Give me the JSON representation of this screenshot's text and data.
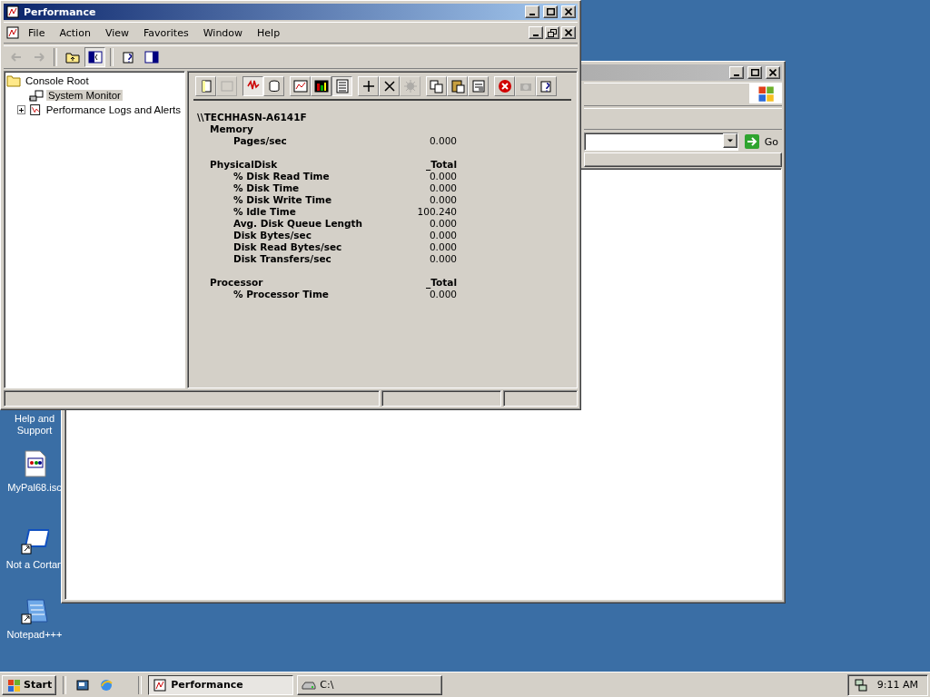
{
  "desktop_icons": [
    {
      "kind": "help",
      "label": "Help and Support"
    },
    {
      "kind": "document",
      "label": "MyPal68.isc"
    },
    {
      "kind": "shortcut-window",
      "label": "Not a Cortan"
    },
    {
      "kind": "notepad",
      "label": "Notepad+++"
    }
  ],
  "background_window": {
    "active": false,
    "address": {
      "go_label": "Go"
    }
  },
  "window": {
    "title": "Performance",
    "active": true,
    "menu": [
      {
        "label": "File"
      },
      {
        "label": "Action"
      },
      {
        "label": "View"
      },
      {
        "label": "Favorites"
      },
      {
        "label": "Window"
      },
      {
        "label": "Help"
      }
    ],
    "toolbar": [
      {
        "kind": "back",
        "disabled": true
      },
      {
        "kind": "forward",
        "disabled": true
      },
      {
        "kind": "sep"
      },
      {
        "kind": "up",
        "disabled": false
      },
      {
        "kind": "tree",
        "disabled": false,
        "pressed": true
      },
      {
        "kind": "sep"
      },
      {
        "kind": "help",
        "disabled": false
      },
      {
        "kind": "panel",
        "disabled": false
      }
    ],
    "tree": [
      {
        "label": "Console Root",
        "kind": "folder",
        "selected": false,
        "expanded": true,
        "children": [
          {
            "label": "System Monitor",
            "kind": "monitor",
            "selected": true
          },
          {
            "label": "Performance Logs and Alerts",
            "kind": "logs",
            "selected": false,
            "expanded": false
          }
        ]
      }
    ],
    "monitor_toolbar": [
      {
        "kind": "new",
        "pressed": false,
        "disabled": false
      },
      {
        "kind": "clear",
        "pressed": false,
        "disabled": true
      },
      {
        "kind": "sep"
      },
      {
        "kind": "current",
        "pressed": true,
        "disabled": false
      },
      {
        "kind": "log",
        "pressed": false,
        "disabled": false
      },
      {
        "kind": "sep"
      },
      {
        "kind": "graph",
        "pressed": false,
        "disabled": false
      },
      {
        "kind": "histogram",
        "pressed": false,
        "disabled": false
      },
      {
        "kind": "report",
        "pressed": true,
        "disabled": false
      },
      {
        "kind": "sep"
      },
      {
        "kind": "add",
        "pressed": false,
        "disabled": false
      },
      {
        "kind": "delete",
        "pressed": false,
        "disabled": false
      },
      {
        "kind": "highlight",
        "pressed": false,
        "disabled": true
      },
      {
        "kind": "sep"
      },
      {
        "kind": "copy",
        "pressed": false,
        "disabled": false
      },
      {
        "kind": "paste",
        "pressed": false,
        "disabled": false
      },
      {
        "kind": "properties",
        "pressed": false,
        "disabled": false
      },
      {
        "kind": "sep"
      },
      {
        "kind": "freeze",
        "pressed": false,
        "disabled": false
      },
      {
        "kind": "update",
        "pressed": false,
        "disabled": true
      },
      {
        "kind": "help",
        "pressed": false,
        "disabled": false
      }
    ],
    "report": {
      "computer": "\\\\TECHHASN-A6141F",
      "objects": [
        {
          "name": "Memory",
          "counters": [
            {
              "name": "Pages/sec",
              "value": "0.000"
            }
          ]
        },
        {
          "name": "PhysicalDisk",
          "instance": "_Total",
          "counters": [
            {
              "name": "% Disk Read Time",
              "value": "0.000"
            },
            {
              "name": "% Disk Time",
              "value": "0.000"
            },
            {
              "name": "% Disk Write Time",
              "value": "0.000"
            },
            {
              "name": "% Idle Time",
              "value": "100.240"
            },
            {
              "name": "Avg. Disk Queue Length",
              "value": "0.000"
            },
            {
              "name": "Disk Bytes/sec",
              "value": "0.000"
            },
            {
              "name": "Disk Read Bytes/sec",
              "value": "0.000"
            },
            {
              "name": "Disk Transfers/sec",
              "value": "0.000"
            }
          ]
        },
        {
          "name": "Processor",
          "instance": "_Total",
          "counters": [
            {
              "name": "% Processor Time",
              "value": "0.000"
            }
          ]
        }
      ]
    }
  },
  "taskbar": {
    "start_label": "Start",
    "quick_launch": [
      {
        "kind": "desktop"
      },
      {
        "kind": "browser"
      }
    ],
    "tasks": [
      {
        "kind": "performance",
        "label": "Performance",
        "selected": true
      },
      {
        "kind": "drive",
        "label": "C:\\",
        "selected": false
      }
    ],
    "clock": "9:11 AM"
  }
}
